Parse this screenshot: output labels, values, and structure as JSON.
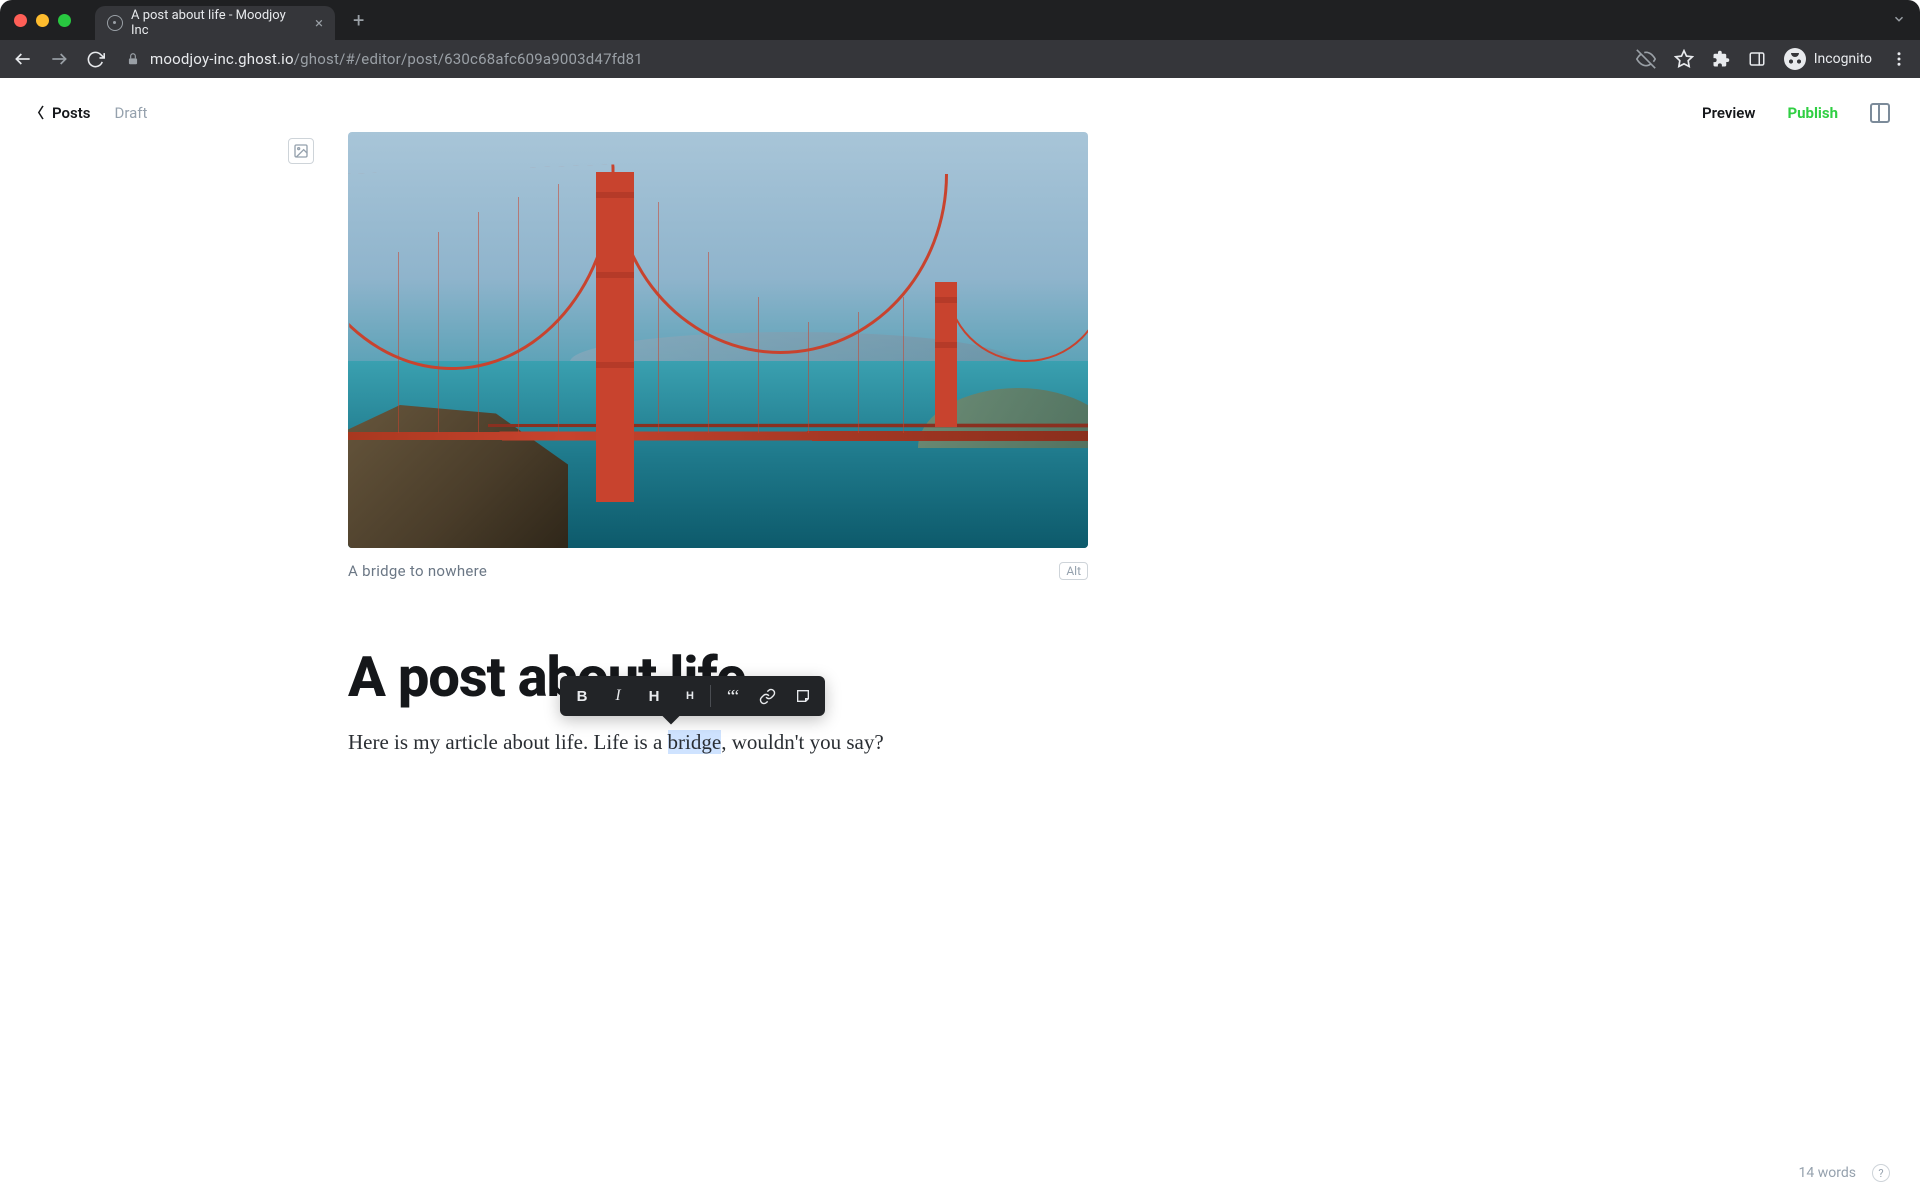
{
  "browser": {
    "tab_title": "A post about life - Moodjoy Inc",
    "url_domain": "moodjoy-inc.ghost.io",
    "url_path": "/ghost/#/editor/post/630c68afc609a9003d47fd81",
    "incognito_label": "Incognito"
  },
  "topbar": {
    "back_label": "Posts",
    "status": "Draft",
    "preview": "Preview",
    "publish": "Publish"
  },
  "image": {
    "caption": "A bridge to nowhere",
    "alt_button": "Alt"
  },
  "post": {
    "title": "A post about life",
    "body_before": "Here is my article about life. Life is a ",
    "body_selected": "bridge",
    "body_after": ", wouldn't you say?"
  },
  "format_toolbar": {
    "bold": "B",
    "italic": "I",
    "heading1": "H",
    "heading2": "H",
    "quote": "““",
    "link": "link",
    "snippet": "snippet"
  },
  "footer": {
    "word_count": "14 words"
  }
}
